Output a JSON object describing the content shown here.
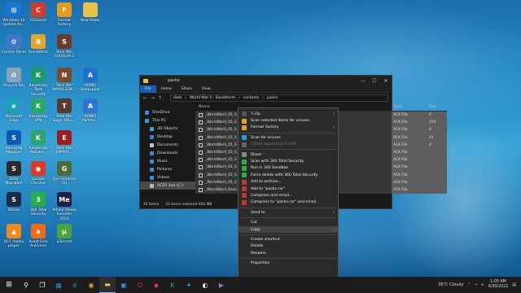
{
  "desktop": {
    "icons": [
      {
        "label": "Windows 10\nUpdate As...",
        "color": "#1a73d9",
        "glyph": "⊞"
      },
      {
        "label": "CCleaner",
        "color": "#d23a2a",
        "glyph": "C"
      },
      {
        "label": "Format\nFactory",
        "color": "#e89a1a",
        "glyph": "F"
      },
      {
        "label": "New folder",
        "color": "#e8c24a",
        "glyph": ""
      },
      {
        "label": "Control Panel",
        "color": "#3f79c6",
        "glyph": "⚙"
      },
      {
        "label": "TunnelBear",
        "color": "#e3a52c",
        "glyph": "B"
      },
      {
        "label": "Total War\nSHOGUN 2",
        "color": "#6a3a2a",
        "glyph": "S"
      },
      {
        "label": "Recycle Bin",
        "color": "#8aa3b8",
        "glyph": "♻"
      },
      {
        "label": "Kaspersky\nTotal Security",
        "color": "#1f9b6b",
        "glyph": "K"
      },
      {
        "label": "Total War\nNAPOLEON...",
        "color": "#7b4b2b",
        "glyph": "N"
      },
      {
        "label": "AOMEI\nBackupper",
        "color": "#1f6fd0",
        "glyph": "A"
      },
      {
        "label": "Microsoft\nEdge",
        "color": "#1ba0b8",
        "glyph": "e"
      },
      {
        "label": "Kaspersky\nVPN",
        "color": "#27a866",
        "glyph": "K"
      },
      {
        "label": "Total War\nSaga: FALL...",
        "color": "#5a3a2a",
        "glyph": "T"
      },
      {
        "label": "AOMEI\nPartitio...",
        "color": "#2d76d4",
        "glyph": "A"
      },
      {
        "label": "Samsung\nMagician",
        "color": "#0b5bb5",
        "glyph": "S"
      },
      {
        "label": "Kaspersky\nPasswo...",
        "color": "#2ba36c",
        "glyph": "K"
      },
      {
        "label": "Total War\nEMPIRE...",
        "color": "#9b1d1d",
        "glyph": "E"
      },
      {
        "label": "Data\nMigration",
        "color": "#2a2a2a",
        "glyph": "S"
      },
      {
        "label": "Google\nChrome",
        "color": "#d93a2a",
        "glyph": "◉"
      },
      {
        "label": "Oxi Generals\nZH",
        "color": "#4a6a3a",
        "glyph": "G"
      },
      {
        "label": "Steam",
        "color": "#1b2a44",
        "glyph": "S"
      },
      {
        "label": "360 Total\nSecurity",
        "color": "#2cae46",
        "glyph": "3"
      },
      {
        "label": "Adobe Media\nEncoder 2021",
        "color": "#1f1f4a",
        "glyph": "Me"
      },
      {
        "label": "VLC media\nplayer",
        "color": "#f08a1a",
        "glyph": "▲"
      },
      {
        "label": "Avast Free\nAntivirus",
        "color": "#f26a1a",
        "glyph": "a"
      },
      {
        "label": "µTorrent",
        "color": "#4aa63a",
        "glyph": "µ"
      }
    ]
  },
  "explorer": {
    "title": "packs",
    "controls": [
      "—",
      "☐",
      "✕"
    ],
    "tabs": [
      "File",
      "Home",
      "Share",
      "View"
    ],
    "path": [
      "data",
      "World War II - Sandstorm",
      "contents",
      "packs"
    ],
    "nav_items": [
      {
        "label": "OneDrive",
        "color": "#3a8be0"
      },
      {
        "label": "This PC",
        "color": "#2f9ad0"
      },
      {
        "label": "3D Objects",
        "color": "#4aa0d8"
      },
      {
        "label": "Desktop",
        "color": "#3a7fd0"
      },
      {
        "label": "Documents",
        "color": "#c8c8c8"
      },
      {
        "label": "Downloads",
        "color": "#3a8fd8"
      },
      {
        "label": "Music",
        "color": "#3a8fd8"
      },
      {
        "label": "Pictures",
        "color": "#3a8fd8"
      },
      {
        "label": "Videos",
        "color": "#3a8fd8"
      },
      {
        "label": "ACER Xxe (C:)",
        "color": "#bbbbbb"
      }
    ],
    "col_name": "Name",
    "col_type": "Type",
    "col_size": "Size",
    "files": [
      "_WorldWarII_05_S",
      "_WorldWarII_05_S",
      "_WorldWarII_05_S",
      "_WorldWarII_05_S",
      "_WorldWarII_05_S",
      "_WorldWarII_05_S",
      "_WorldWarII_05_S",
      "_WorldWarII_05_S",
      "_WorldWarII_05_S",
      "_WorldWarII_05_S",
      "_WorldWarII_Base"
    ],
    "file_types": [
      "ACK File",
      "ACK File",
      "ACK File",
      "ACK File",
      "ACK File",
      "ACK File",
      "ACK File",
      "ACK File",
      "ACK File",
      "ACK File",
      "ACK File"
    ],
    "file_sizes": [
      "4",
      "150",
      "4",
      "21",
      "4",
      "",
      "",
      "",
      "",
      "",
      ""
    ],
    "status_count": "22 items",
    "status_selected": "22 items selected  604 MB"
  },
  "context_menu": {
    "items": [
      {
        "label": "7-Zip",
        "color": "#555555",
        "arrow": true
      },
      {
        "label": "Scan selected items for viruses",
        "color": "#f0a020"
      },
      {
        "label": "Format Factory",
        "color": "#e0a020",
        "arrow": true
      },
      {
        "sep": true
      },
      {
        "label": "Scan for viruses",
        "color": "#1fa0e0"
      },
      {
        "label": "Check reputation in KSN",
        "color": "#666666",
        "dim": true
      },
      {
        "sep": true
      },
      {
        "label": "Share",
        "color": "#888888"
      },
      {
        "label": "Scan with 360 Total Security",
        "color": "#2cae46"
      },
      {
        "label": "Run in 360 Sandbox",
        "color": "#2cae46"
      },
      {
        "label": "Force delete with 360 Total Security",
        "color": "#2cae46"
      },
      {
        "label": "Add to archive...",
        "color": "#c0392b"
      },
      {
        "label": "Add to \"packs.rar\"",
        "color": "#c0392b"
      },
      {
        "label": "Compress and email...",
        "color": "#c0392b"
      },
      {
        "label": "Compress to \"packs.rar\" and email",
        "color": "#c0392b"
      },
      {
        "sep": true
      },
      {
        "label": "Send to",
        "color": "",
        "arrow": true
      },
      {
        "sep": true
      },
      {
        "label": "Cut",
        "color": ""
      },
      {
        "label": "Copy",
        "color": "",
        "hover": true
      },
      {
        "sep": true
      },
      {
        "label": "Create shortcut",
        "color": ""
      },
      {
        "label": "Delete",
        "color": ""
      },
      {
        "label": "Rename",
        "color": ""
      },
      {
        "sep": true
      },
      {
        "label": "Properties",
        "color": ""
      }
    ]
  },
  "taskbar": {
    "start": "⊞",
    "icons": [
      {
        "name": "search-icon",
        "glyph": "⚲",
        "color": "#ffffff"
      },
      {
        "name": "task-view-icon",
        "glyph": "❐",
        "color": "#ffffff"
      },
      {
        "name": "widgets-icon",
        "glyph": "▦",
        "color": "#2a86d8"
      },
      {
        "name": "edge-icon",
        "glyph": "e",
        "color": "#1ba0b8"
      },
      {
        "name": "chrome-icon",
        "glyph": "◉",
        "color": "#e0a020"
      },
      {
        "name": "file-explorer-icon",
        "glyph": "▬",
        "color": "#e8c24a",
        "active": true
      },
      {
        "name": "store-icon",
        "glyph": "▣",
        "color": "#3a8fd8"
      },
      {
        "name": "opera-icon",
        "glyph": "O",
        "color": "#e03030"
      },
      {
        "name": "app-icon",
        "glyph": "◆",
        "color": "#d04040"
      },
      {
        "name": "kaspersky-icon",
        "glyph": "K",
        "color": "#2ba36c"
      },
      {
        "name": "app2-icon",
        "glyph": "✦",
        "color": "#30b0b0"
      },
      {
        "name": "app3-icon",
        "glyph": "◐",
        "color": "#f0f0f0"
      },
      {
        "name": "app4-icon",
        "glyph": "▶",
        "color": "#a070e0"
      }
    ],
    "weather": "26°C  Cloudy",
    "time": "1:05 AM",
    "date": "9/30/2022"
  }
}
